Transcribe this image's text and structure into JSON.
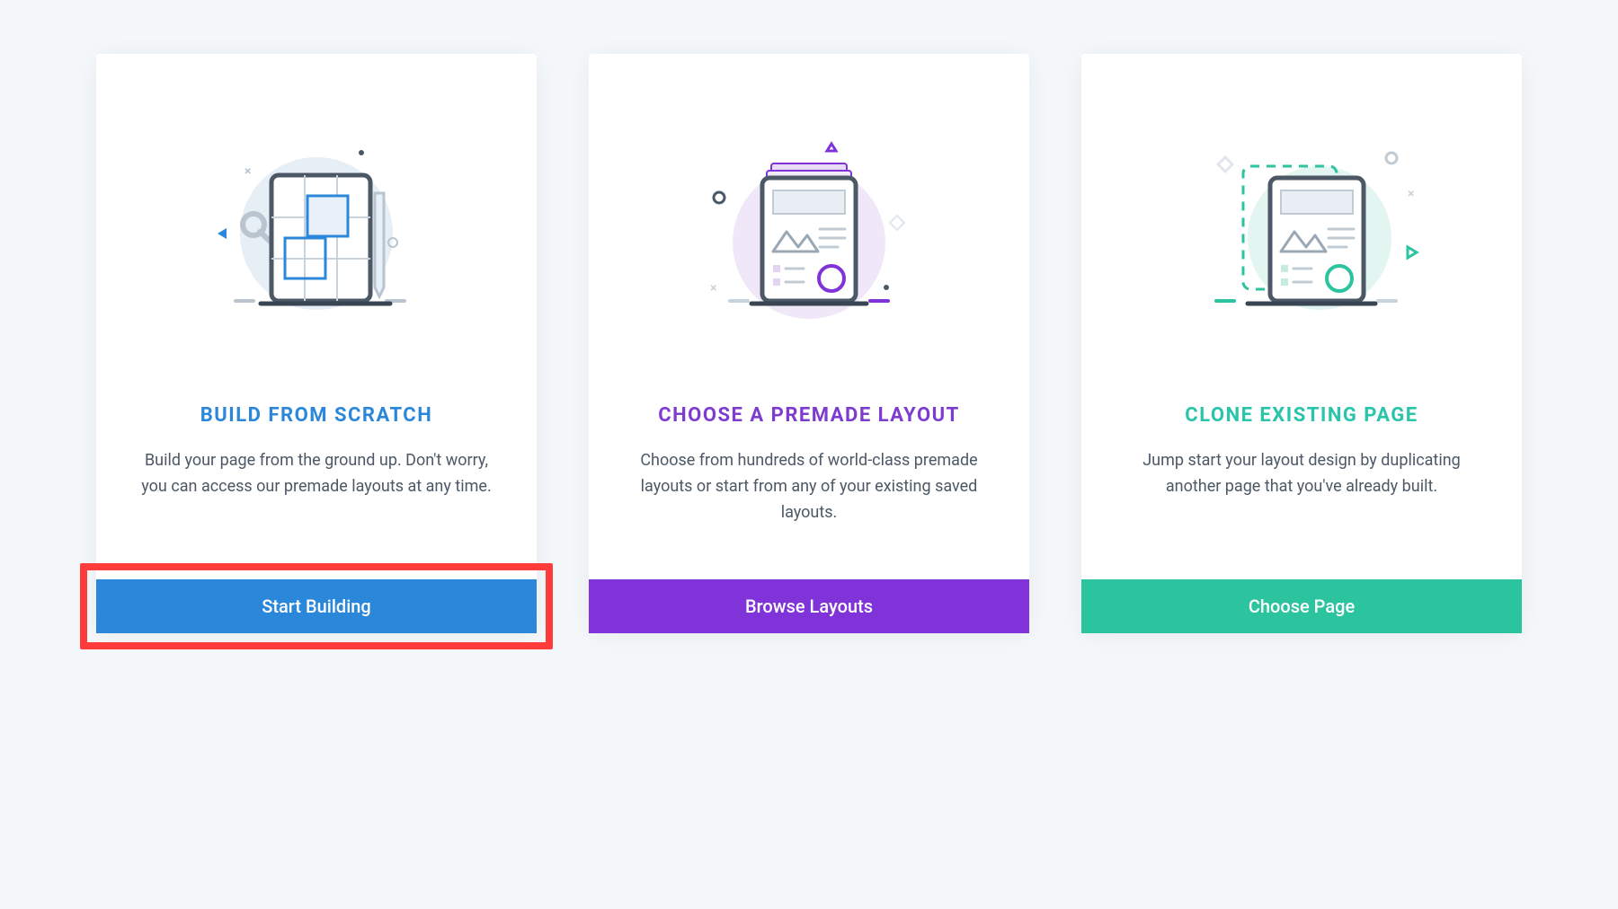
{
  "cards": [
    {
      "title": "BUILD FROM SCRATCH",
      "description": "Build your page from the ground up. Don't worry, you can access our premade layouts at any time.",
      "button_label": "Start Building",
      "highlighted": true
    },
    {
      "title": "CHOOSE A PREMADE LAYOUT",
      "description": "Choose from hundreds of world-class premade layouts or start from any of your existing saved layouts.",
      "button_label": "Browse Layouts",
      "highlighted": false
    },
    {
      "title": "CLONE EXISTING PAGE",
      "description": "Jump start your layout design by duplicating another page that you've already built.",
      "button_label": "Choose Page",
      "highlighted": false
    }
  ],
  "colors": {
    "blue": "#2b87da",
    "purple": "#7e3bd0",
    "teal": "#29c4a9",
    "highlight": "#ff3b3b"
  }
}
